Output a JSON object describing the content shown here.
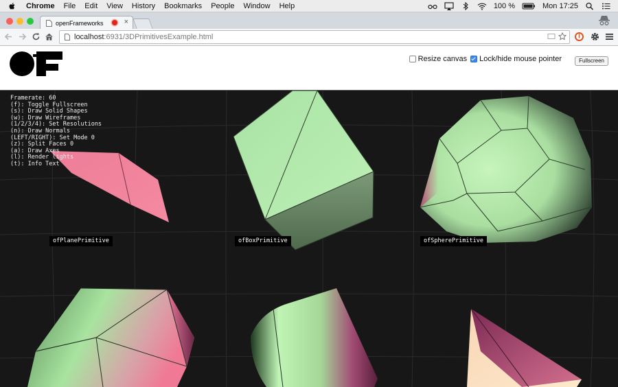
{
  "menubar": {
    "app_name": "Chrome",
    "items": [
      "File",
      "Edit",
      "View",
      "History",
      "Bookmarks",
      "People",
      "Window",
      "Help"
    ],
    "battery": "100 %",
    "clock": "Mon 17:25"
  },
  "tab": {
    "title": "openFrameworks"
  },
  "omnibox": {
    "host": "localhost",
    "path": ":6931/3DPrimitivesExample.html"
  },
  "controls": {
    "resize_label": "Resize canvas",
    "resize_checked": false,
    "lock_label": "Lock/hide mouse pointer",
    "lock_checked": true,
    "fullscreen_label": "Fullscreen"
  },
  "info_lines": [
    "Framerate: 60",
    "(f): Toggle Fullscreen",
    "(s): Draw Solid Shapes",
    "(w): Draw Wireframes",
    "(1/2/3/4): Set Resolutions",
    "(n): Draw Normals",
    "(LEFT/RIGHT): Set Mode 0",
    "(z): Split Faces 0",
    "(a): Draw Axes",
    "(l): Render lights",
    "(t): Info Text"
  ],
  "primitive_labels": {
    "plane": "ofPlanePrimitive",
    "box": "ofBoxPrimitive",
    "sphere": "ofSpherePrimitive"
  },
  "icons": {
    "apple": "apple-icon",
    "back": "back-arrow-icon",
    "forward": "forward-arrow-icon",
    "reload": "reload-icon",
    "home": "home-icon",
    "star": "bookmark-star-icon",
    "settings": "gear-icon",
    "menu": "hamburger-menu-icon"
  },
  "colors": {
    "pink": "#f07a95",
    "green": "#a8e4a0",
    "canvas_bg": "#171717"
  }
}
